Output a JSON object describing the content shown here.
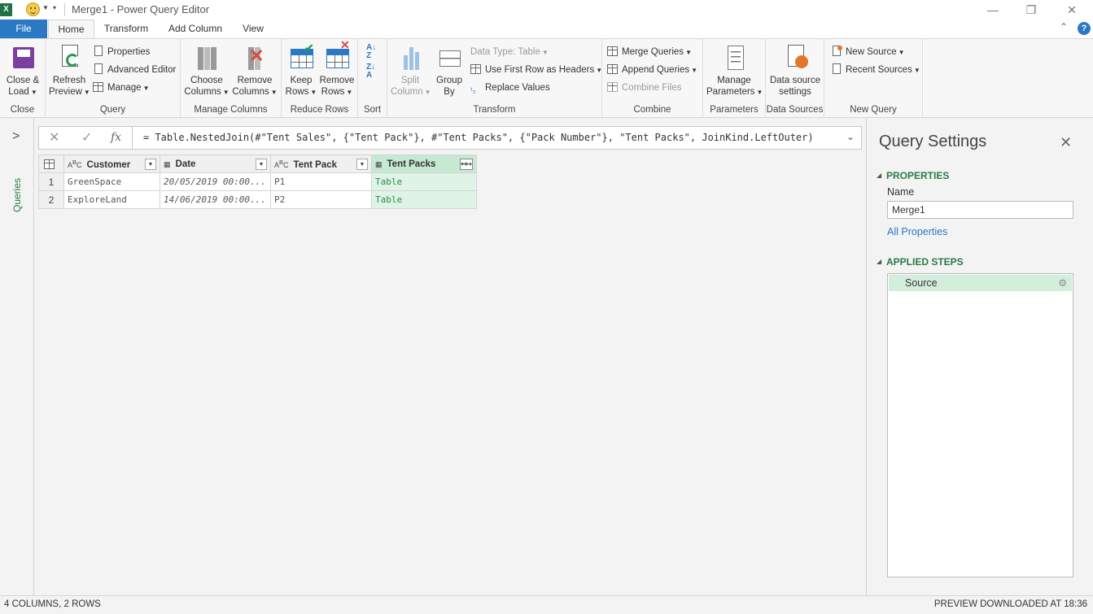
{
  "window": {
    "title": "Merge1 - Power Query Editor"
  },
  "tabs": [
    "File",
    "Home",
    "Transform",
    "Add Column",
    "View"
  ],
  "ribbon": {
    "close": {
      "label1": "Close &",
      "label2": "Load",
      "group": "Close"
    },
    "query": {
      "refresh1": "Refresh",
      "refresh2": "Preview",
      "properties": "Properties",
      "advanced_editor": "Advanced Editor",
      "manage": "Manage",
      "group": "Query"
    },
    "manage_columns": {
      "choose1": "Choose",
      "choose2": "Columns",
      "remove1": "Remove",
      "remove2": "Columns",
      "group": "Manage Columns"
    },
    "reduce_rows": {
      "keep1": "Keep",
      "keep2": "Rows",
      "remove1": "Remove",
      "remove2": "Rows",
      "group": "Reduce Rows"
    },
    "sort": {
      "group": "Sort"
    },
    "transform": {
      "split1": "Split",
      "split2": "Column",
      "group_by1": "Group",
      "group_by2": "By",
      "data_type": "Data Type: Table",
      "first_row": "Use First Row as Headers",
      "replace": "Replace Values",
      "group": "Transform"
    },
    "combine": {
      "merge": "Merge Queries",
      "append": "Append Queries",
      "combine_files": "Combine Files",
      "group": "Combine"
    },
    "parameters": {
      "label1": "Manage",
      "label2": "Parameters",
      "group": "Parameters"
    },
    "data_sources": {
      "label1": "Data source",
      "label2": "settings",
      "group": "Data Sources"
    },
    "new_query": {
      "new_source": "New Source",
      "recent_sources": "Recent Sources",
      "group": "New Query"
    }
  },
  "queries_pane": {
    "label": "Queries"
  },
  "formula": "= Table.NestedJoin(#\"Tent Sales\", {\"Tent Pack\"}, #\"Tent Packs\", {\"Pack Number\"}, \"Tent Packs\", JoinKind.LeftOuter)",
  "grid": {
    "columns": [
      {
        "name": "Customer",
        "type": "ABC"
      },
      {
        "name": "Date",
        "type": "date"
      },
      {
        "name": "Tent Pack",
        "type": "ABC"
      },
      {
        "name": "Tent Packs",
        "type": "table"
      }
    ],
    "rows": [
      {
        "num": "1",
        "customer": "GreenSpace",
        "date": "20/05/2019 00:00...",
        "pack": "P1",
        "packs": "Table"
      },
      {
        "num": "2",
        "customer": "ExploreLand",
        "date": "14/06/2019 00:00...",
        "pack": "P2",
        "packs": "Table"
      }
    ]
  },
  "settings": {
    "title": "Query Settings",
    "properties": "PROPERTIES",
    "name_label": "Name",
    "name_value": "Merge1",
    "all_properties": "All Properties",
    "applied_steps": "APPLIED STEPS",
    "steps": [
      "Source"
    ]
  },
  "status": {
    "left": "4 COLUMNS, 2 ROWS",
    "right": "PREVIEW DOWNLOADED AT 18:36"
  }
}
